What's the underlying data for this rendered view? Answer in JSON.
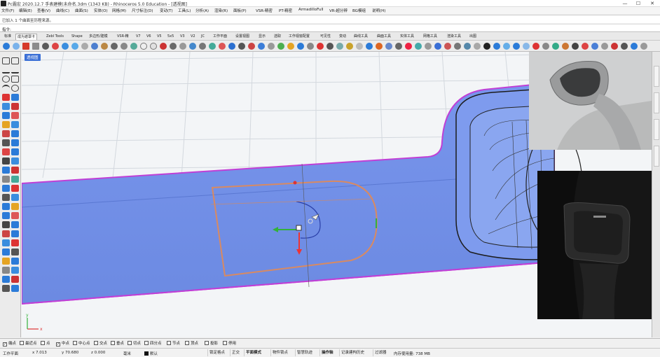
{
  "window": {
    "title": "Pc霸宏 2020.12.7 手表建模(未命名.3dm (1343 KB) - Rhinoceros 5.0 Education - [透视图]",
    "minimize": "—",
    "maximize": "☐",
    "close": "✕"
  },
  "menu": [
    "文件(F)",
    "编辑(E)",
    "查看(V)",
    "曲线(C)",
    "曲面(S)",
    "实体(O)",
    "网格(M)",
    "尺寸标注(D)",
    "变动(T)",
    "工具(L)",
    "分析(A)",
    "渲染(R)",
    "面板(P)",
    "VSR-精密",
    "PT-精密",
    "ArmadilloFull",
    "VR-超分辨",
    "BG模组",
    "说明(H)"
  ],
  "command": {
    "history": "已加入 1 个曲面至历程来源。",
    "prompt": "指令:",
    "value": ""
  },
  "tabs": [
    "标准",
    "成为遮罩卡",
    "Zebl Tools",
    "Shape",
    "多边形/建模",
    "VSR-精",
    "V7",
    "V6",
    "V5",
    "5x5",
    "V3",
    "V2",
    "JC",
    "工作平面",
    "设置视图",
    "显示",
    "选取",
    "工作视窗配置",
    "可见性",
    "变动",
    "曲线工具",
    "曲面工具",
    "实体工具",
    "网格工具",
    "渲染工具",
    "出图"
  ],
  "active_tab": 1,
  "toolbar_icons": [
    "new-file-icon",
    "open-icon",
    "save-icon",
    "print-icon",
    "cut-icon",
    "copy-icon",
    "paste-icon",
    "undo-icon",
    "redo-icon",
    "pan-icon",
    "rotate-view-icon",
    "zoom-icon",
    "zoom-window-icon",
    "zoom-extents-icon",
    "select-icon",
    "layer-icon",
    "properties-icon",
    "render-icon",
    "material-icon",
    "light-icon",
    "options-icon",
    "help-icon"
  ],
  "viewport": {
    "label": "透视图",
    "axis_x": "x",
    "axis_y": "y"
  },
  "osnap": {
    "items": [
      {
        "label": "端点",
        "checked": true
      },
      {
        "label": "最近点",
        "checked": false
      },
      {
        "label": "点",
        "checked": false
      },
      {
        "label": "中点",
        "checked": true
      },
      {
        "label": "中心点",
        "checked": false
      },
      {
        "label": "交点",
        "checked": false
      },
      {
        "label": "垂点",
        "checked": false
      },
      {
        "label": "切点",
        "checked": false
      },
      {
        "label": "四分点",
        "checked": false
      },
      {
        "label": "节点",
        "checked": false
      },
      {
        "label": "顶点",
        "checked": false
      }
    ],
    "project": "投影",
    "disable": "停用"
  },
  "status": {
    "plane": "工作平面",
    "x": "x 7.013",
    "y": "y 70.680",
    "z": "z 0.000",
    "unit": "毫米",
    "layer": "默认",
    "buttons": [
      "锁定格点",
      "正交",
      "平面模式",
      "物件锁点",
      "智慧轨迹",
      "操作轴",
      "记录建构历史",
      "过滤器"
    ],
    "buttons_on": [
      false,
      false,
      true,
      false,
      false,
      true,
      false,
      false
    ],
    "memory": "内存使用量: 738 MB"
  },
  "colors": {
    "surface": "#6f8fe8",
    "surface_edge": "#c03fd6",
    "curve": "#d88a62",
    "accent": "#3a6fd6"
  }
}
